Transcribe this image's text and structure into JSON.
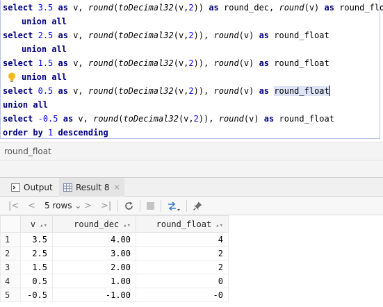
{
  "editor": {
    "lines": [
      {
        "kw1": "select",
        "num1": "3.5",
        "kw2": "as",
        "t1": " v, ",
        "f1": "round",
        "t2": "(",
        "f2": "toDecimal32",
        "t3": "(v,",
        "num2": "2",
        "t4": ")) ",
        "kw3": "as",
        "t5": " round_dec, ",
        "f3": "round",
        "t6": "(v) ",
        "kw4": "as",
        "t7": " round_float"
      },
      {
        "kw1": "union all"
      },
      {
        "kw1": "select",
        "num1": "2.5",
        "kw2": "as",
        "t1": " v, ",
        "f1": "round",
        "t2": "(",
        "f2": "toDecimal32",
        "t3": "(v,",
        "num2": "2",
        "t4": ")), ",
        "f3": "round",
        "t5": "(v) ",
        "kw3": "as",
        "t6": " round_float"
      },
      {
        "kw1": "union all"
      },
      {
        "kw1": "select",
        "num1": "1.5",
        "kw2": "as",
        "t1": " v, ",
        "f1": "round",
        "t2": "(",
        "f2": "toDecimal32",
        "t3": "(v,",
        "num2": "2",
        "t4": ")), ",
        "f3": "round",
        "t5": "(v) ",
        "kw3": "as",
        "t6": " round_float"
      },
      {
        "kw1": "union all"
      },
      {
        "kw1": "select",
        "num1": "0.5",
        "kw2": "as",
        "t1": " v, ",
        "f1": "round",
        "t2": "(",
        "f2": "toDecimal32",
        "t3": "(v,",
        "num2": "2",
        "t4": ")), ",
        "f3": "round",
        "t5": "(v) ",
        "kw3": "as",
        "t6": "round_float"
      },
      {
        "kw1": "union all"
      },
      {
        "kw1": "select",
        "num1": "-0.5",
        "kw2": "as",
        "t1": " v, ",
        "f1": "round",
        "t2": "(",
        "f2": "toDecimal32",
        "t3": "(v,",
        "num2": "2",
        "t4": ")), ",
        "f3": "round",
        "t5": "(v) ",
        "kw3": "as",
        "t6": " round_float"
      },
      {
        "kw1": "order by",
        "num1": "1",
        "kw2": "descending"
      }
    ]
  },
  "breadcrumb": {
    "label": "round_float"
  },
  "tabs": {
    "output": {
      "label": "Output"
    },
    "result": {
      "label": "Result 8",
      "close": "×"
    }
  },
  "toolbar": {
    "first": "|<",
    "prev": "<",
    "rows": "5 rows",
    "rows_caret": "⌄",
    "next": ">",
    "last": ">|"
  },
  "grid": {
    "columns": [
      "v",
      "round_dec",
      "round_float"
    ],
    "rows": [
      {
        "n": "1",
        "v": "3.5",
        "dec": "4.00",
        "flt": "4"
      },
      {
        "n": "2",
        "v": "2.5",
        "dec": "3.00",
        "flt": "2"
      },
      {
        "n": "3",
        "v": "1.5",
        "dec": "2.00",
        "flt": "2"
      },
      {
        "n": "4",
        "v": "0.5",
        "dec": "1.00",
        "flt": "0"
      },
      {
        "n": "5",
        "v": "-0.5",
        "dec": "-1.00",
        "flt": "-0"
      }
    ]
  },
  "icons": {
    "sort": "sort-icon",
    "bulb": "lightbulb-icon"
  }
}
